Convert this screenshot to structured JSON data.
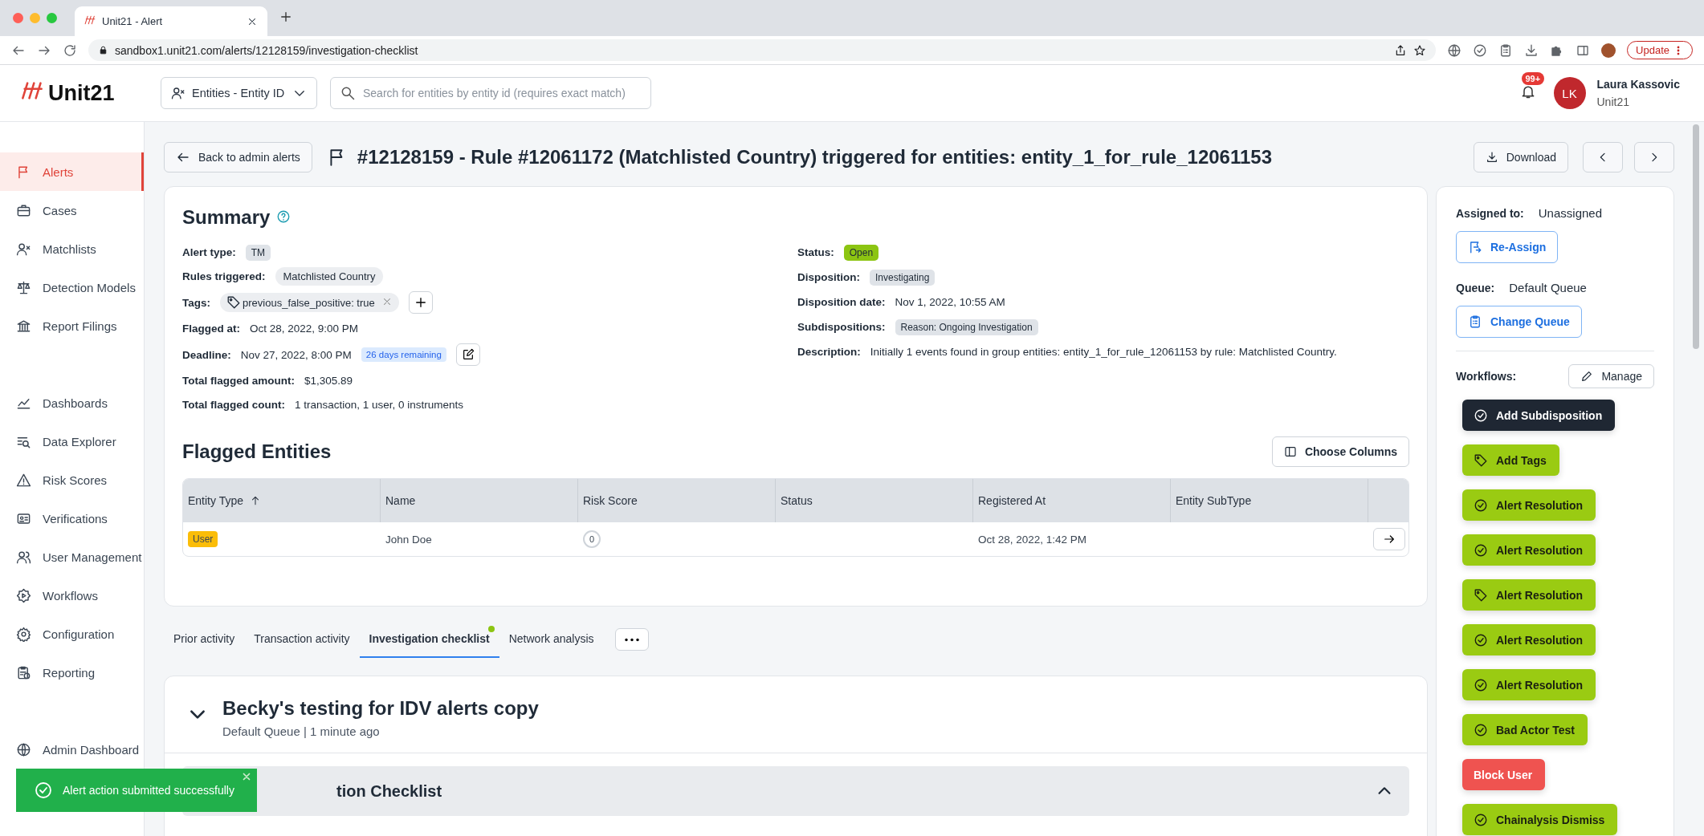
{
  "browser": {
    "tab_title": "Unit21 - Alert",
    "url": "sandbox1.unit21.com/alerts/12128159/investigation-checklist",
    "update_button": "Update"
  },
  "header": {
    "logo": "Unit21",
    "entity_select": "Entities - Entity ID",
    "search": {
      "placeholder": "Search for entities by entity id (requires exact match)"
    },
    "notifications": "99+",
    "avatar": "LK",
    "user_name": "Laura Kassovic",
    "user_org": "Unit21"
  },
  "sidebar": {
    "items": [
      {
        "label": "Alerts",
        "selected": true
      },
      {
        "label": "Cases",
        "selected": false
      },
      {
        "label": "Matchlists",
        "selected": false
      },
      {
        "label": "Detection Models",
        "selected": false
      },
      {
        "label": "Report Filings",
        "selected": false
      },
      {
        "label": "Dashboards",
        "selected": false
      },
      {
        "label": "Data Explorer",
        "selected": false
      },
      {
        "label": "Risk Scores",
        "selected": false
      },
      {
        "label": "Verifications",
        "selected": false
      },
      {
        "label": "User Management",
        "selected": false
      },
      {
        "label": "Workflows",
        "selected": false
      },
      {
        "label": "Configuration",
        "selected": false
      },
      {
        "label": "Reporting",
        "selected": false
      },
      {
        "label": "Admin Dashboard",
        "selected": false
      }
    ]
  },
  "back_button": "Back to admin alerts",
  "title": "#12128159 - Rule #12061172 (Matchlisted Country) triggered for entities: entity_1_for_rule_12061153",
  "download_button": "Download",
  "summary": {
    "title": "Summary",
    "left": [
      {
        "label": "Alert type:",
        "kind": "chip",
        "value": "TM"
      },
      {
        "label": "Rules triggered:",
        "kind": "pill",
        "value": "Matchlisted Country"
      },
      {
        "label": "Tags:",
        "kind": "tag",
        "value": "previous_false_positive: true"
      },
      {
        "label": "Flagged at:",
        "kind": "text",
        "value": "Oct 28, 2022, 9:00 PM"
      },
      {
        "label": "Deadline:",
        "kind": "deadline",
        "value": "Nov 27, 2022, 8:00 PM",
        "note": "26 days remaining"
      },
      {
        "label": "Total flagged amount:",
        "kind": "text",
        "value": "$1,305.89"
      },
      {
        "label": "Total flagged count:",
        "kind": "text",
        "value": "1 transaction, 1 user, 0 instruments"
      }
    ],
    "right": [
      {
        "label": "Status:",
        "kind": "status",
        "value": "Open"
      },
      {
        "label": "Disposition:",
        "kind": "chip",
        "value": "Investigating"
      },
      {
        "label": "Disposition date:",
        "kind": "text",
        "value": "Nov 1, 2022, 10:55 AM"
      },
      {
        "label": "Subdispositions:",
        "kind": "chip",
        "value": "Reason: Ongoing Investigation"
      },
      {
        "label": "Description:",
        "kind": "text",
        "value": "Initially 1 events found in group entities: entity_1_for_rule_12061153 by rule: Matchlisted Country."
      }
    ]
  },
  "flagged_entities": {
    "title": "Flagged Entities",
    "choose_columns": "Choose Columns",
    "columns": [
      {
        "label": "Entity Type",
        "sorted": true
      },
      {
        "label": "Name",
        "sorted": false
      },
      {
        "label": "Risk Score",
        "sorted": false
      },
      {
        "label": "Status",
        "sorted": false
      },
      {
        "label": "Registered At",
        "sorted": false
      },
      {
        "label": "Entity SubType",
        "sorted": false
      }
    ],
    "rows": [
      {
        "entity_type": "User",
        "name": "John Doe",
        "risk_score": "0",
        "registered_at": "Oct 28, 2022, 1:42 PM"
      }
    ]
  },
  "tabs": [
    {
      "label": "Prior activity",
      "selected": false,
      "dot": false
    },
    {
      "label": "Transaction activity",
      "selected": false,
      "dot": false
    },
    {
      "label": "Investigation checklist",
      "selected": true,
      "dot": true
    },
    {
      "label": "Network analysis",
      "selected": false,
      "dot": false
    }
  ],
  "checklist": {
    "title": "Becky's testing for IDV alerts copy",
    "subtitle": "Default Queue | 1 minute ago",
    "section": "tion Checklist"
  },
  "assignment": {
    "assigned_label": "Assigned to:",
    "assigned_value": "Unassigned",
    "reassign_button": "Re-Assign",
    "queue_label": "Queue:",
    "queue_value": "Default Queue",
    "change_queue_button": "Change Queue",
    "workflows_label": "Workflows:",
    "manage_button": "Manage"
  },
  "workflows": [
    {
      "label": "Add Subdisposition",
      "kind": "dark"
    },
    {
      "label": "Add Tags",
      "kind": "green"
    },
    {
      "label": "Alert Resolution",
      "kind": "green"
    },
    {
      "label": "Alert Resolution",
      "kind": "green"
    },
    {
      "label": "Alert Resolution",
      "kind": "green"
    },
    {
      "label": "Alert Resolution",
      "kind": "green"
    },
    {
      "label": "Alert Resolution",
      "kind": "green"
    },
    {
      "label": "Bad Actor Test",
      "kind": "green"
    },
    {
      "label": "Block User",
      "kind": "red"
    },
    {
      "label": "Chainalysis Dismiss",
      "kind": "green"
    }
  ],
  "toast": {
    "message": "Alert action submitted successfully"
  }
}
